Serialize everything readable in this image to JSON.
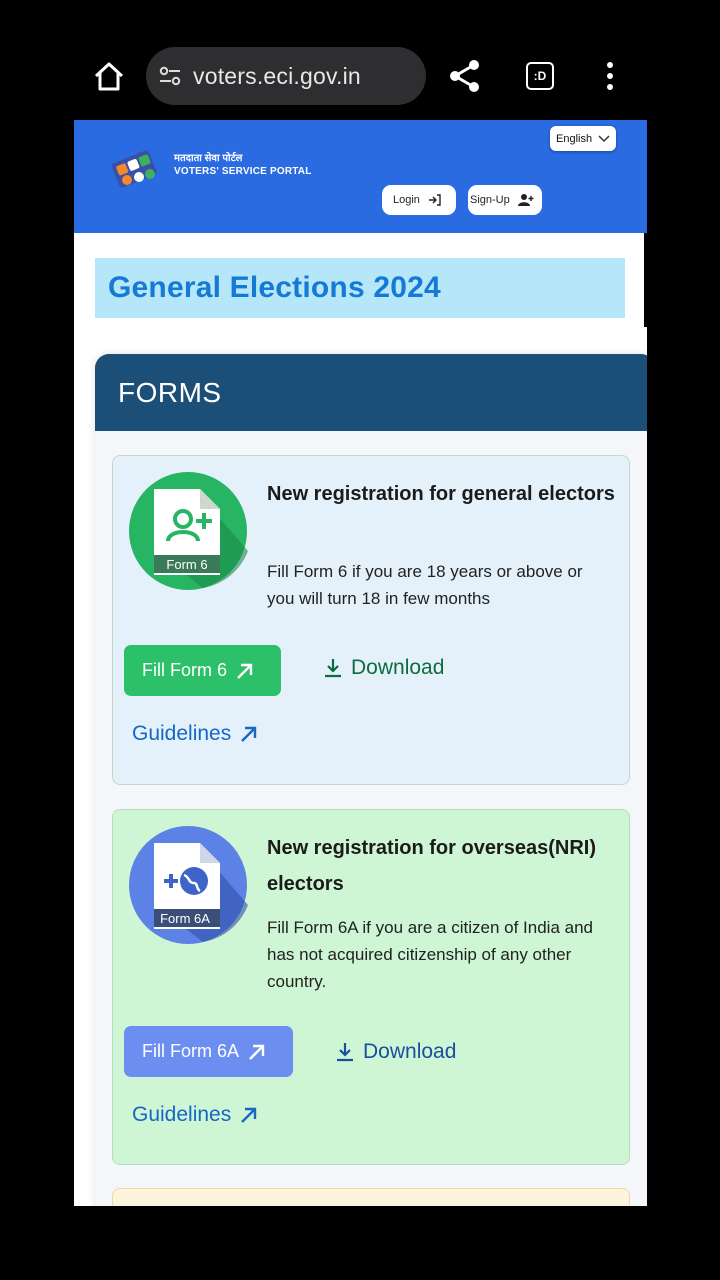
{
  "browser": {
    "url": "voters.eci.gov.in",
    "tab_label": ":D"
  },
  "header": {
    "brand_hindi": "मतदाता सेवा पोर्टल",
    "brand_english": "VOTERS' SERVICE PORTAL",
    "language": "English",
    "login_label": "Login",
    "signup_label": "Sign-Up",
    "color": "#2a6be2"
  },
  "banner": {
    "title": "General Elections 2024"
  },
  "forms": {
    "section_title": "FORMS",
    "cards": [
      {
        "icon_label": "Form 6",
        "title": "New registration for general electors",
        "description": "Fill Form 6 if you are 18 years or above or you will turn 18 in few months",
        "fill_label": "Fill Form 6",
        "download_label": "Download",
        "guidelines_label": "Guidelines",
        "accent": "#2cc069"
      },
      {
        "icon_label": "Form 6A",
        "title": "New registration for overseas(NRI) electors",
        "description": "Fill Form 6A if you are a citizen of India and has not acquired citizenship of any other country.",
        "fill_label": "Fill Form 6A",
        "download_label": "Download",
        "guidelines_label": "Guidelines",
        "accent": "#6b8ef0"
      }
    ]
  }
}
